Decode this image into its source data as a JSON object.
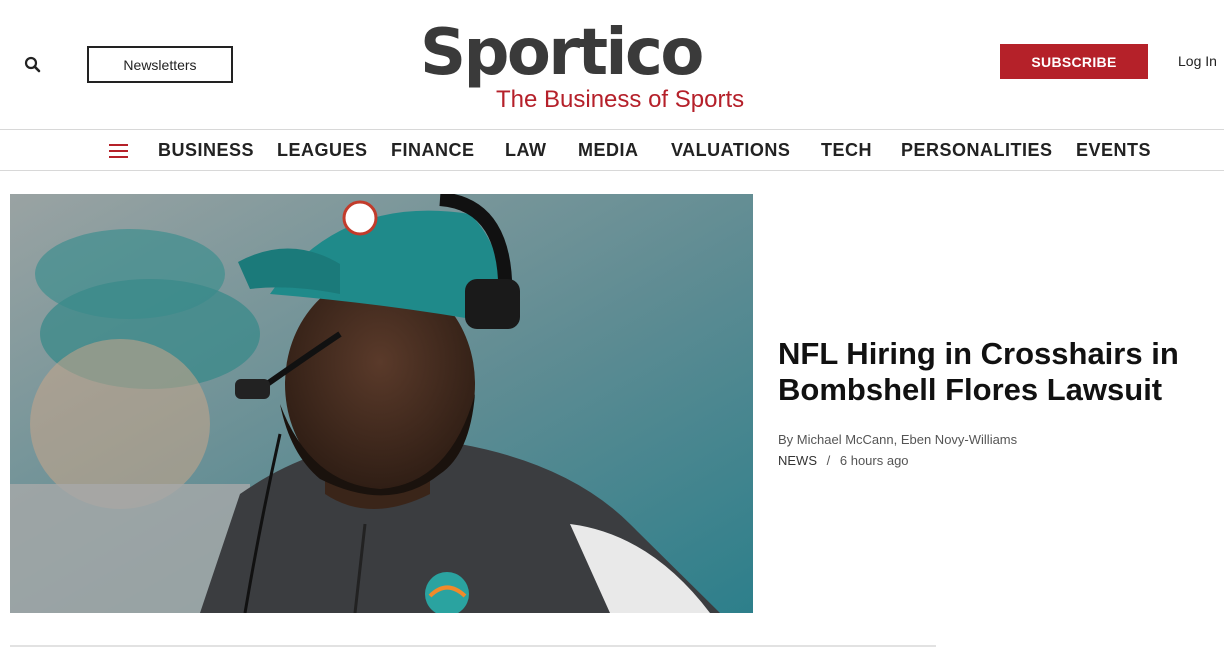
{
  "header": {
    "newsletters_label": "Newsletters",
    "logo_text": "Sportico",
    "logo_tagline": "The Business of Sports",
    "subscribe_label": "SUBSCRIBE",
    "login_label": "Log In",
    "icons": {
      "search": "search-icon",
      "menu": "hamburger-menu-icon"
    }
  },
  "nav": {
    "items": [
      "BUSINESS",
      "LEAGUES",
      "FINANCE",
      "LAW",
      "MEDIA",
      "VALUATIONS",
      "TECH",
      "PERSONALITIES",
      "EVENTS"
    ]
  },
  "article": {
    "headline": "NFL Hiring in Crosshairs in Bombshell Flores Lawsuit",
    "by_prefix": "By",
    "authors": "Michael McCann, Eben Novy-Williams",
    "category": "NEWS",
    "separator": "/",
    "timestamp": "6 hours ago",
    "image_alt": "Miami Dolphins coach wearing a teal cap and headset"
  },
  "colors": {
    "brand_red": "#b52129",
    "logo_gray": "#3a3a3a",
    "text_dark": "#111111",
    "text_muted": "#555555",
    "teal": "#1f8c8c"
  }
}
